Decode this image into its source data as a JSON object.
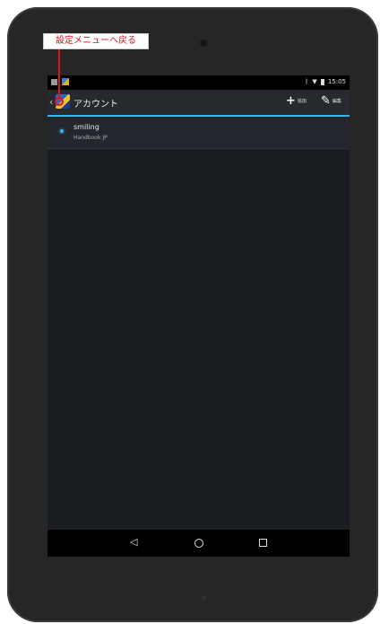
{
  "annotation": {
    "text": "設定メニューへ戻る"
  },
  "status_bar": {
    "time": "15:05",
    "bluetooth_icon": "bluetooth-icon",
    "wifi_icon": "wifi-icon",
    "battery_icon": "battery-icon"
  },
  "action_bar": {
    "title": "アカウント",
    "add": {
      "symbol": "+",
      "label": "追加"
    },
    "edit": {
      "symbol": "✎",
      "label": "編集"
    }
  },
  "accounts": [
    {
      "name": "smiling",
      "type": "Handbook JP"
    }
  ],
  "nav": {
    "back": "◁",
    "home_icon": "home-icon",
    "recent_icon": "recent-apps-icon"
  },
  "colors": {
    "accent": "#33b5e5",
    "annotation": "#e01515",
    "background": "#1a1d22"
  }
}
